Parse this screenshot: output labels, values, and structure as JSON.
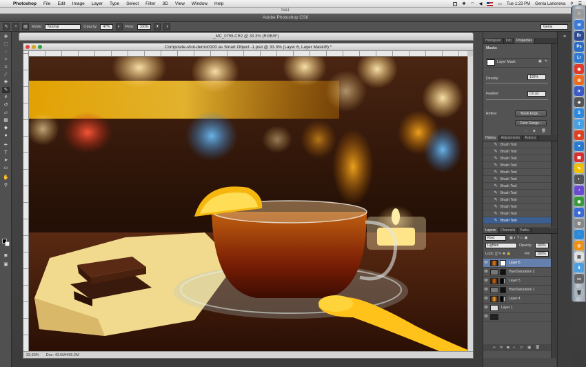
{
  "menubar": {
    "app": "Photoshop",
    "items": [
      "File",
      "Edit",
      "Image",
      "Layer",
      "Type",
      "Select",
      "Filter",
      "3D",
      "View",
      "Window",
      "Help"
    ],
    "clock": "Tue 1:23 PM",
    "user": "Genia Larionova"
  },
  "window_strip_title": "tea1",
  "app_title": "Adobe Photoshop CS6",
  "options": {
    "mode_label": "Mode:",
    "mode_value": "Normal",
    "opacity_label": "Opacity:",
    "opacity_value": "47%",
    "flow_label": "Flow:",
    "flow_value": "100%",
    "workspace": "Genia"
  },
  "back_doc_title": "_MC_0755.CR2 @ 33.3% (RGB/8*)",
  "doc": {
    "title": "Composite-shot-demo0100 as Smart Object -1.psd @ 33.3% (Layer 6, Layer Mask/8) *",
    "zoom": "33.33%",
    "doc_size": "Doc: 43.6M/465.2M"
  },
  "properties": {
    "tabs": [
      "Histogram",
      "Info",
      "Properties"
    ],
    "section": "Masks",
    "mask_label": "Layer Mask",
    "density_label": "Density:",
    "density_value": "100%",
    "feather_label": "Feather:",
    "feather_value": "0.0 px",
    "refine_label": "Refine:",
    "mask_edge_btn": "Mask Edge...",
    "color_range_btn": "Color Range..."
  },
  "history": {
    "tabs": [
      "History",
      "Adjustments",
      "Actions"
    ],
    "items": [
      "Brush Tool",
      "Brush Tool",
      "Brush Tool",
      "Brush Tool",
      "Brush Tool",
      "Brush Tool",
      "Brush Tool",
      "Brush Tool",
      "Brush Tool",
      "Brush Tool",
      "Brush Tool",
      "Brush Tool"
    ]
  },
  "layers": {
    "tabs": [
      "Layers",
      "Channels",
      "Paths"
    ],
    "kind": "Kind",
    "blend": "Lighten",
    "opacity_label": "Opacity:",
    "opacity_value": "100%",
    "lock_label": "Lock:",
    "fill_label": "Fill:",
    "fill_value": "100%",
    "rows": [
      "Layer 6",
      "Hue/Saturation 2",
      "Layer 5",
      "Hue/Saturation 1",
      "Layer 4",
      "Layer 1"
    ],
    "footer": "fx"
  },
  "toolbox_icons": [
    "move-tool",
    "marquee-tool",
    "lasso-tool",
    "quick-select-tool",
    "crop-tool",
    "eyedropper-tool",
    "healing-tool",
    "brush-tool",
    "clone-tool",
    "history-brush-tool",
    "eraser-tool",
    "gradient-tool",
    "blur-tool",
    "dodge-tool",
    "pen-tool",
    "type-tool",
    "path-select-tool",
    "shape-tool",
    "hand-tool",
    "zoom-tool"
  ],
  "colors": {
    "accent": "#3c5f8f",
    "layer_selected": "#6580ad"
  }
}
